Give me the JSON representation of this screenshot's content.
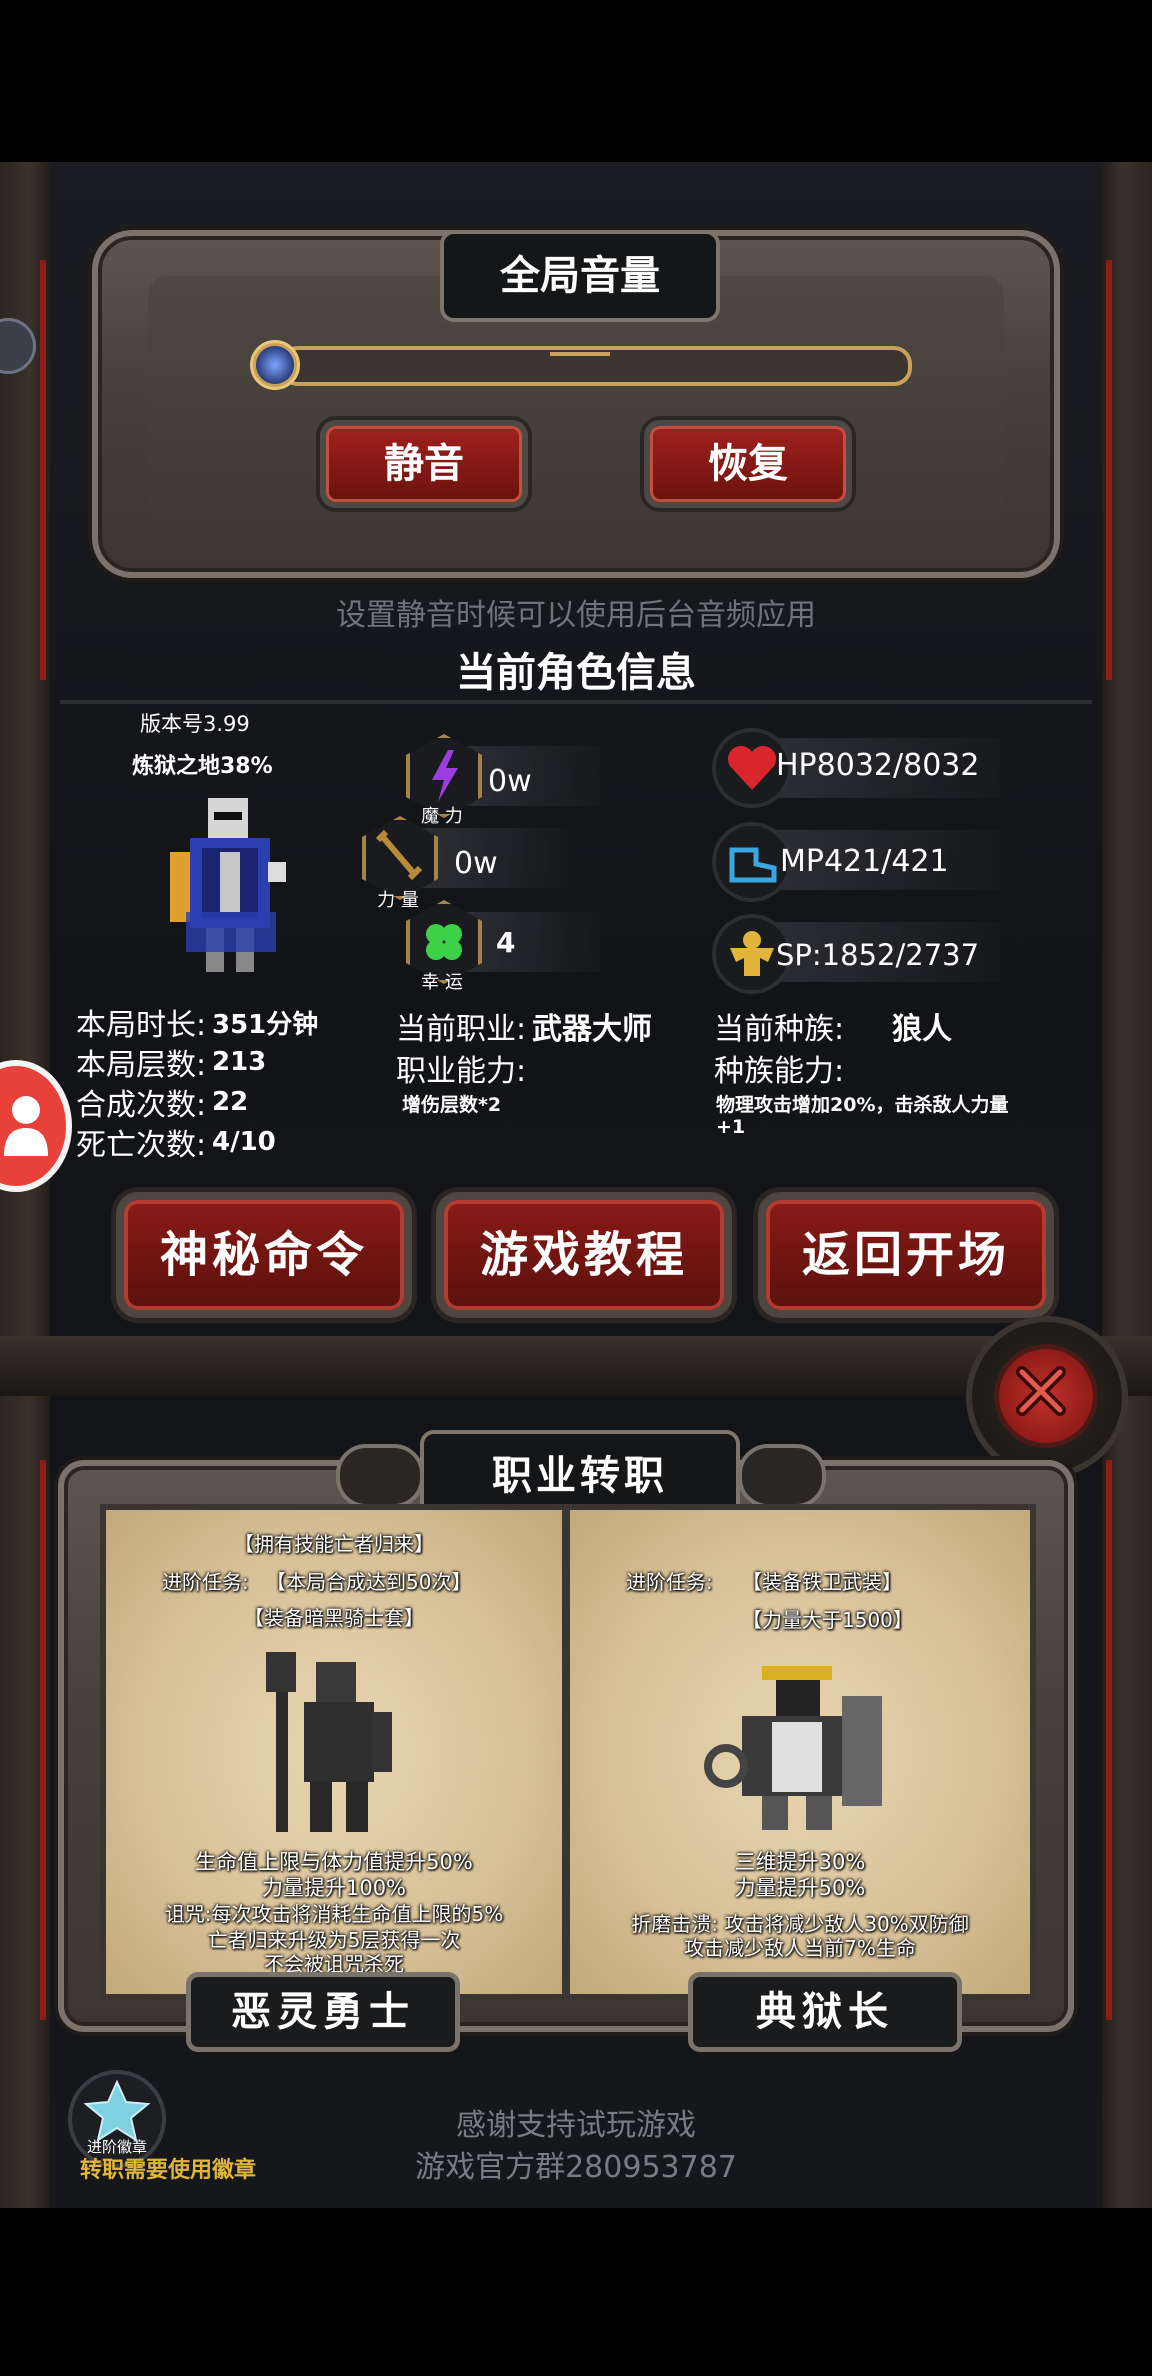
{
  "volume": {
    "title": "全局音量",
    "level": 0,
    "mute_label": "静音",
    "restore_label": "恢复",
    "hint": "设置静音时候可以使用后台音频应用"
  },
  "character": {
    "section_title": "当前角色信息",
    "version": "版本号3.99",
    "progress": "炼狱之地38%",
    "stats": {
      "magic_label": "魔 力",
      "magic_value": "0w",
      "power_label": "力 量",
      "power_value": "0w",
      "luck_label": "幸 运",
      "luck_value": "4"
    },
    "hp": "HP8032/8032",
    "mp": "MP421/421",
    "sp": "SP:1852/2737",
    "left_info": [
      {
        "label": "本局时长:",
        "value": "351分钟"
      },
      {
        "label": "本局层数:",
        "value": "213"
      },
      {
        "label": "合成次数:",
        "value": "22"
      },
      {
        "label": "死亡次数:",
        "value": "4/10"
      }
    ],
    "job_label": "当前职业:",
    "job_value": "武器大师",
    "job_ability_label": "职业能力:",
    "job_ability_value": "增伤层数*2",
    "race_label": "当前种族:",
    "race_value": "狼人",
    "race_ability_label": "种族能力:",
    "race_ability_value": "物理攻击增加20%，击杀敌人力量+1"
  },
  "buttons": {
    "secret": "神秘命令",
    "tutorial": "游戏教程",
    "back": "返回开场"
  },
  "job_change": {
    "title": "职业转职",
    "cards": [
      {
        "req_label": "进阶任务:",
        "reqs": [
          "【拥有技能亡者归来】",
          "【本局合成达到50次】",
          "【装备暗黑骑士套】"
        ],
        "effects": [
          "生命值上限与体力值提升50%",
          "力量提升100%",
          "诅咒:每次攻击将消耗生命值上限的5%",
          "亡者归来升级为5层获得一次",
          "不会被诅咒杀死"
        ],
        "name": "恶灵勇士"
      },
      {
        "req_label": "进阶任务:",
        "reqs": [
          "【装备铁卫武装】",
          "【力量大于1500】"
        ],
        "effects": [
          "三维提升30%",
          "力量提升50%",
          "折磨击溃: 攻击将减少敌人30%双防御",
          "攻击减少敌人当前7%生命"
        ],
        "name": "典狱长"
      }
    ]
  },
  "badge": {
    "label": "进阶徽章",
    "note": "转职需要使用徽章"
  },
  "footer": {
    "thanks": "感谢支持试玩游戏",
    "group": "游戏官方群280953787"
  },
  "colors": {
    "accent_red": "#8e1d17",
    "gold": "#e0b53a",
    "parchment": "#d9c39a"
  }
}
